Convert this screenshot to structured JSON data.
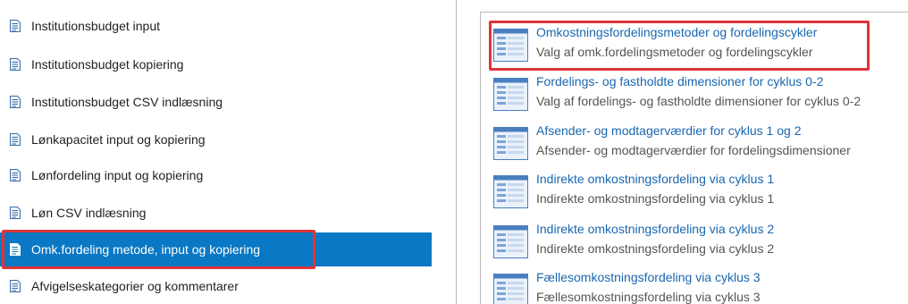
{
  "left_nav": {
    "items": [
      {
        "label": "Institutionsbudget input"
      },
      {
        "label": "Institutionsbudget kopiering"
      },
      {
        "label": "Institutionsbudget CSV indlæsning"
      },
      {
        "label": "Lønkapacitet input og kopiering"
      },
      {
        "label": "Lønfordeling input og kopiering"
      },
      {
        "label": "Løn CSV indlæsning"
      },
      {
        "label": "Omk.fordeling metode, input og kopiering"
      },
      {
        "label": "Afvigelseskategorier og kommentarer"
      }
    ],
    "selected_label": "Omk.fordeling metode, input og kopiering"
  },
  "right_panel": {
    "tiles": [
      {
        "title": "Omkostningsfordelingsmetoder og fordelingscykler",
        "subtitle": "Valg af omk.fordelingsmetoder og fordelingscykler"
      },
      {
        "title": "Fordelings- og fastholdte dimensioner for cyklus 0-2",
        "subtitle": "Valg af fordelings- og fastholdte dimensioner for cyklus 0-2"
      },
      {
        "title": "Afsender- og modtagerværdier for cyklus 1 og 2",
        "subtitle": "Afsender- og modtagerværdier for fordelingsdimensioner"
      },
      {
        "title": "Indirekte omkostningsfordeling via cyklus 1",
        "subtitle": "Indirekte omkostningsfordeling via cyklus 1"
      },
      {
        "title": "Indirekte omkostningsfordeling via cyklus 2",
        "subtitle": "Indirekte omkostningsfordeling via cyklus 2"
      },
      {
        "title": "Fællesomkostningsfordeling via cyklus 3",
        "subtitle": "Fællesomkostningsfordeling via cyklus 3"
      }
    ]
  },
  "colors": {
    "selected_bg": "#0a78c4",
    "highlight": "#e0343a",
    "link": "#1a67b0"
  }
}
